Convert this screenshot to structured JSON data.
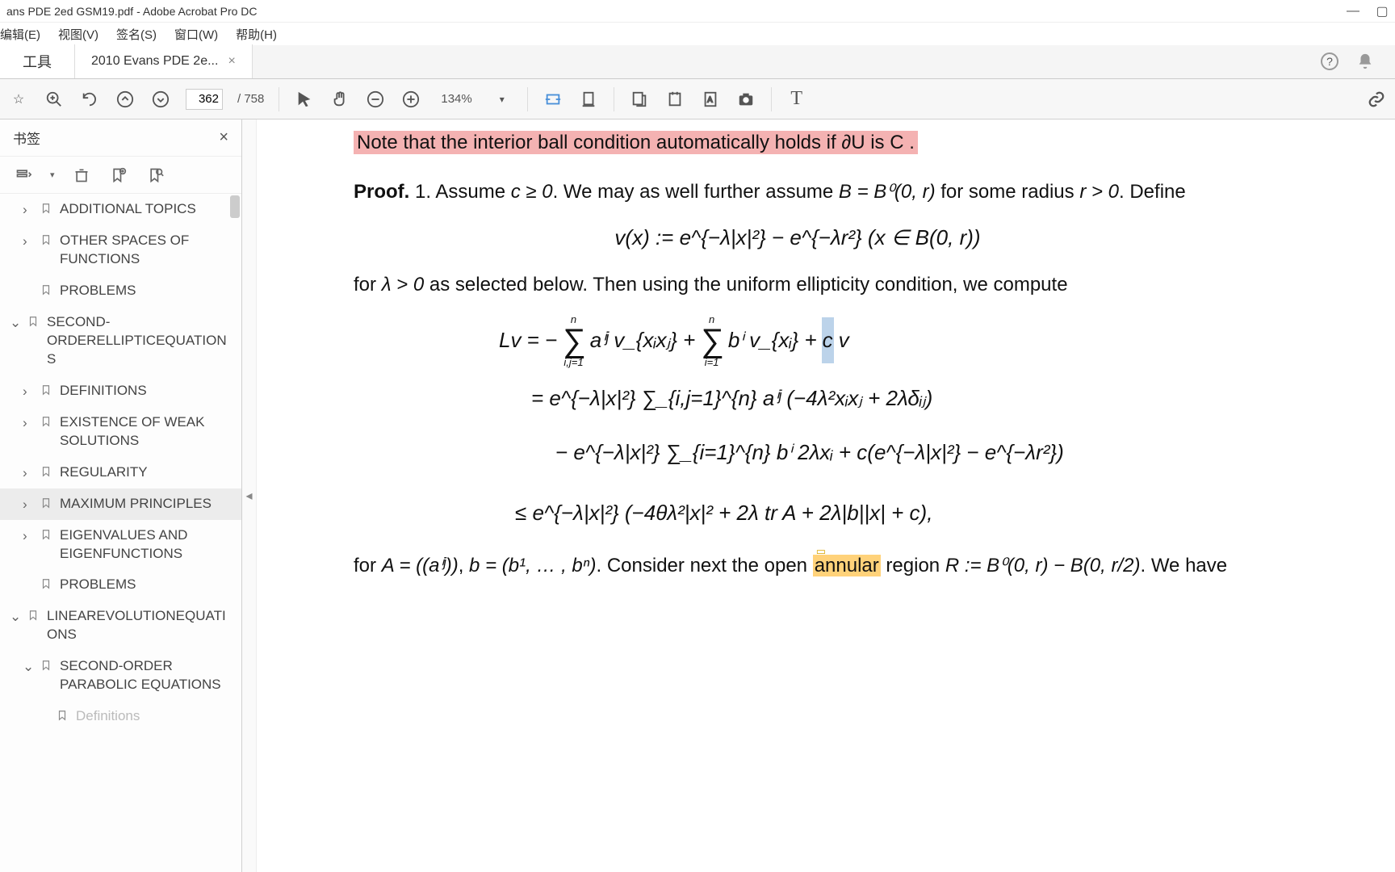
{
  "window": {
    "title": "ans PDE 2ed GSM19.pdf - Adobe Acrobat Pro DC"
  },
  "menu": {
    "edit": "编辑(E)",
    "view": "视图(V)",
    "sign": "签名(S)",
    "window": "窗口(W)",
    "help": "帮助(H)"
  },
  "tabs": {
    "tools": "工具",
    "doc": "2010 Evans PDE 2e...",
    "close": "×"
  },
  "toolbar": {
    "page_current": "362",
    "page_sep": "/ 758",
    "zoom": "134%"
  },
  "sidebar": {
    "title": "书签",
    "items": [
      {
        "label": "ADDITIONAL TOPICS",
        "arrow": ">",
        "indent": 1
      },
      {
        "label": "OTHER SPACES OF FUNCTIONS",
        "arrow": ">",
        "indent": 1
      },
      {
        "label": "PROBLEMS",
        "arrow": "",
        "indent": 1
      },
      {
        "label": "SECOND-ORDERELLIPTICEQUATIONS",
        "arrow": "v",
        "indent": 0
      },
      {
        "label": "DEFINITIONS",
        "arrow": ">",
        "indent": 1
      },
      {
        "label": "EXISTENCE OF WEAK SOLUTIONS",
        "arrow": ">",
        "indent": 1
      },
      {
        "label": "REGULARITY",
        "arrow": ">",
        "indent": 1
      },
      {
        "label": "MAXIMUM PRINCIPLES",
        "arrow": ">",
        "indent": 1,
        "selected": true
      },
      {
        "label": "EIGENVALUES AND EIGENFUNCTIONS",
        "arrow": ">",
        "indent": 1
      },
      {
        "label": "PROBLEMS",
        "arrow": "",
        "indent": 1
      },
      {
        "label": "LINEAREVOLUTIONEQUATIONS",
        "arrow": "v",
        "indent": 0
      },
      {
        "label": "SECOND-ORDER PARABOLIC EQUATIONS",
        "arrow": "v",
        "indent": 1
      },
      {
        "label": "Definitions",
        "arrow": "",
        "indent": 2,
        "faded": true
      }
    ]
  },
  "doc": {
    "highlighted_top": "Note that the interior ball condition automatically holds if ∂U is C .",
    "proof_label": "Proof.",
    "line1a": " 1. Assume ",
    "line1b": "c ≥ 0",
    "line1c": ". We may as well further assume ",
    "line1d": "B = B⁰(0, r)",
    "line1e": " for some radius ",
    "line1f": "r > 0",
    "line1g": ". Define",
    "eq1": "v(x) := e^{−λ|x|²} − e^{−λr²}     (x ∈ B(0, r))",
    "line2a": "for ",
    "line2b": "λ > 0",
    "line2c": " as selected below.  Then using the uniform ellipticity condition, we compute",
    "eq2_l1_pre": "Lv = − ",
    "eq2_l1_sum1": "∑",
    "eq2_l1_top1": "n",
    "eq2_l1_bot1": "i,j=1",
    "eq2_l1_mid1": " aⁱʲ v_{xᵢxⱼ} + ",
    "eq2_l1_sum2": "∑",
    "eq2_l1_top2": "n",
    "eq2_l1_bot2": "i=1",
    "eq2_l1_mid2": " bⁱ v_{xᵢ} + ",
    "eq2_l1_sel": "c",
    "eq2_l1_end": "v",
    "eq2_l2": "= e^{−λ|x|²} ∑_{i,j=1}^{n} aⁱʲ (−4λ²xᵢxⱼ + 2λδᵢⱼ)",
    "eq2_l3": "− e^{−λ|x|²} ∑_{i=1}^{n} bⁱ 2λxᵢ + c(e^{−λ|x|²} − e^{−λr²})",
    "eq2_l4": "≤ e^{−λ|x|²} (−4θλ²|x|² + 2λ tr A + 2λ|b||x| + c),",
    "line3a": "for ",
    "line3b": "A = ((aⁱʲ))",
    "line3c": ", ",
    "line3d": "b = (b¹, … , bⁿ)",
    "line3e": ".  Consider next the open ",
    "annular": "annular",
    "line3f": " region ",
    "line3g": "R := B⁰(0, r) − B(0, r/2)",
    "line3h": ". We have"
  }
}
